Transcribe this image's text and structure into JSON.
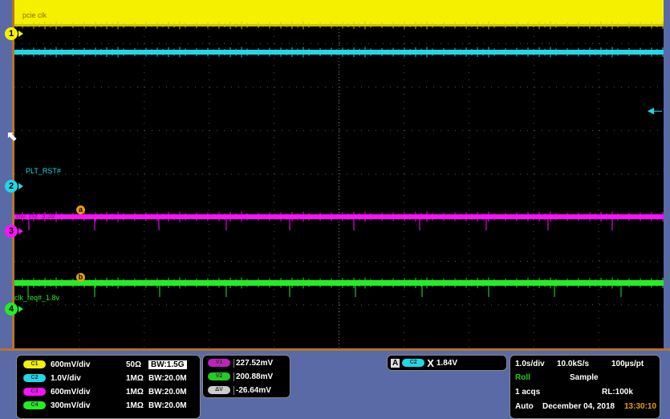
{
  "colors": {
    "ch1": "#f5f000",
    "ch2": "#1fd8e8",
    "ch3": "#ff10ff",
    "ch4": "#22ee22",
    "cursor": "#e8a000"
  },
  "traces": {
    "ch1_label": "pcie clk",
    "ch2_label": "PLT_RST#",
    "ch3_label": "pw_rst_3.3v",
    "ch4_label": "clk_req#_1.8v"
  },
  "markers": {
    "ch1": "1",
    "ch2": "2",
    "ch3": "3",
    "ch4": "4",
    "cursor_a": "a",
    "cursor_b": "b"
  },
  "channels": [
    {
      "name": "C1",
      "scale": "600mV/div",
      "impedance": "50Ω",
      "bw": "BW:1.5G"
    },
    {
      "name": "C2",
      "scale": "1.0V/div",
      "impedance": "1MΩ",
      "bw": "BW:20.0M"
    },
    {
      "name": "C3",
      "scale": "600mV/div",
      "impedance": "1MΩ",
      "bw": "BW:20.0M"
    },
    {
      "name": "C4",
      "scale": "300mV/div",
      "impedance": "1MΩ",
      "bw": "BW:20.0M"
    }
  ],
  "cursors": [
    {
      "name": "V1",
      "value": "227.52mV"
    },
    {
      "name": "V2",
      "value": "200.88mV"
    },
    {
      "name": "ΔV",
      "value": "-26.64mV"
    }
  ],
  "trigger": {
    "mode": "A",
    "source": "C2",
    "slope": "X",
    "level": "1.84V"
  },
  "acquisition": {
    "timebase": "1.0s/div",
    "sample_rate": "10.0kS/s",
    "resolution": "100µs/pt",
    "mode": "Roll",
    "sampling": "Sample",
    "acqs": "1 acqs",
    "record_length": "RL:100k",
    "trigger_mode": "Auto",
    "date": "December 04, 2018",
    "time": "13:30:10"
  }
}
